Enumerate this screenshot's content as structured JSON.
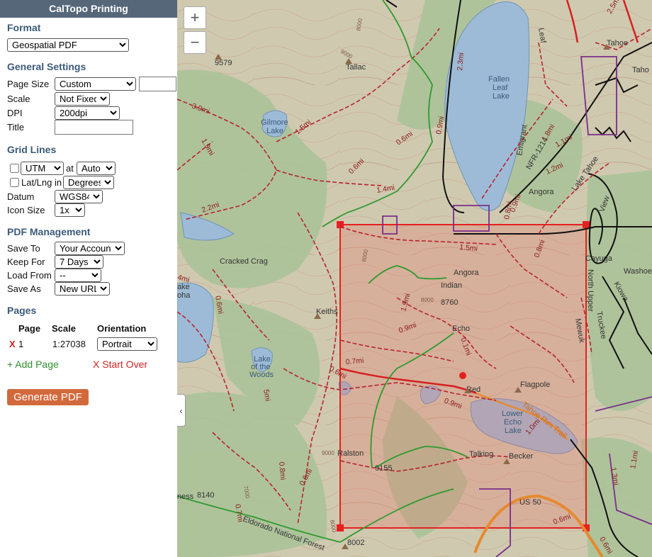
{
  "panel": {
    "title": "CalTopo Printing",
    "format": {
      "heading": "Format",
      "value": "Geospatial PDF"
    },
    "general": {
      "heading": "General Settings",
      "page_size_label": "Page Size",
      "page_size_value": "Custom",
      "scale_label": "Scale",
      "scale_value": "Not Fixed",
      "dpi_label": "DPI",
      "dpi_value": "200dpi",
      "title_label": "Title"
    },
    "grid": {
      "heading": "Grid Lines",
      "utm_value": "UTM",
      "at_label": "at",
      "auto_value": "Auto",
      "latlng_label": "Lat/Lng in",
      "degrees_value": "Degrees",
      "datum_label": "Datum",
      "datum_value": "WGS84",
      "iconsize_label": "Icon Size",
      "iconsize_value": "1x"
    },
    "pdf": {
      "heading": "PDF Management",
      "saveto_label": "Save To",
      "saveto_value": "Your Account",
      "keepfor_label": "Keep For",
      "keepfor_value": "7 Days",
      "loadfrom_label": "Load From",
      "loadfrom_value": "--",
      "saveas_label": "Save As",
      "saveas_value": "New URL"
    },
    "pages": {
      "heading": "Pages",
      "col_page": "Page",
      "col_scale": "Scale",
      "col_orientation": "Orientation",
      "rows": [
        {
          "remove": "X",
          "page": "1",
          "scale": "1:27038",
          "orientation": "Portrait"
        }
      ],
      "add_label": "+ Add Page",
      "startover_label": "X Start Over"
    },
    "generate_label": "Generate PDF"
  },
  "map": {
    "zoom_in": "+",
    "zoom_out": "−",
    "collapse": "‹",
    "labels": {
      "tallac": "Tallac",
      "fallen1": "Fallen",
      "fallen2": "Leaf",
      "fallen3": "Lake",
      "gilmore1": "Gilmore",
      "gilmore2": "Lake",
      "e9579": "9579",
      "tahoe": "Tahoe",
      "tahoe2": "Taho",
      "cracked": "Cracked Crag",
      "angora": "Angora",
      "angora2": "Angora",
      "indian": "Indian",
      "e8760": "8760",
      "keiths": "Keiths",
      "echo": "Echo",
      "lotw1": "Lake",
      "lotw2": "of the",
      "lotw3": "Woods",
      "red": "Red",
      "flagpole": "Flagpole",
      "lowerecho1": "Lower",
      "lowerecho2": "Echo",
      "lowerecho3": "Lake",
      "trail": "Tahoe Rim Trail",
      "ralston": "Ralston",
      "e9155": "9155",
      "talking": "Talking",
      "becker": "Becker",
      "e8140": "8140",
      "e8002": "8002",
      "us50": "US 50",
      "forest": "Eldorado National Forest",
      "washoe": "Washoe",
      "nfr": "NFR-1214",
      "emigrant": "Emigrant",
      "lake_tahoe": "Lake Tahoe",
      "view": "View",
      "cayuga": "Cayuga",
      "north_upper": "North Upper",
      "truckee": "Truckee",
      "mewuk": "Mewuk",
      "kiowa": "Kiowa",
      "leaf": "Leaf",
      "ake": "ake",
      "oha": "oha",
      "ness": "ness",
      "d15a": "1.5mi",
      "d15b": "1.5mi",
      "d06a": "0.6mi",
      "d06b": "0.6mi",
      "d14": "1.4mi",
      "d39": "3.9mi",
      "d19a": "1.9mi",
      "d19b": "1.9mi",
      "d22": "2.2mi",
      "d23": "2.3mi",
      "d09a": "0.9mi",
      "d09b": "0.9mi",
      "d09c": "0.9mi",
      "d09d": "0.9mi",
      "d18": "1.8mi",
      "d12": "1.2mi",
      "d11a": "1.1mi",
      "d11b": "1.1mi",
      "d08a": "0.8mi",
      "d08b": "0.8mi",
      "d08c": "0.8mi",
      "d07a": "0.7mi",
      "d07b": "0.7mi",
      "d10": "1.0mi",
      "d06c": "0.6mi",
      "d06d": "0.6mi",
      "d06e": "0.6mi",
      "d06f": "0.6mi",
      "d06g": "0.6mi",
      "d01": "0.1mi",
      "d25": "2.5mi",
      "d13": "1.3mi",
      "d05": "5mi",
      "d4": "4mi",
      "c8000a": "8000",
      "c8000b": "8000",
      "c8000c": "8000",
      "c9000a": "9000",
      "c9000b": "9000",
      "c7000": "7000",
      "c8000d": "8000"
    }
  }
}
